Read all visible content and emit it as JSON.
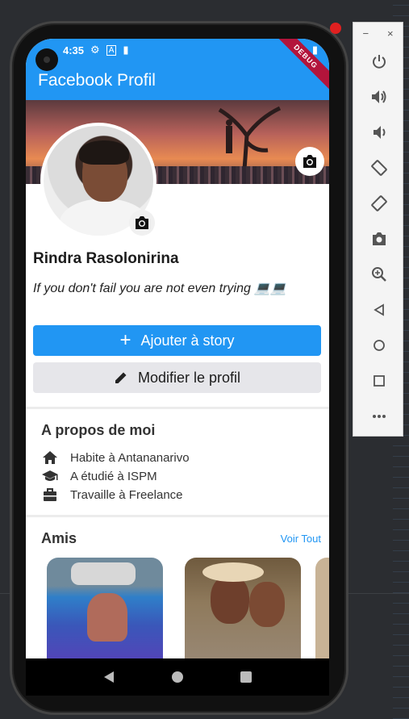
{
  "status_bar": {
    "time": "4:35"
  },
  "app_bar": {
    "title": "Facebook Profil",
    "debug_banner": "DEBUG"
  },
  "profile": {
    "name": "Rindra Rasolonirina",
    "bio": "If you don't fail you are not even trying 💻💻"
  },
  "buttons": {
    "add_story_label": "Ajouter à story",
    "edit_profile_label": "Modifier le profil"
  },
  "about": {
    "title": "A propos de moi",
    "items": [
      {
        "icon": "home-icon",
        "text": "Habite à Antananarivo"
      },
      {
        "icon": "school-icon",
        "text": "A étudié à ISPM"
      },
      {
        "icon": "briefcase-icon",
        "text": "Travaille à Freelance"
      }
    ]
  },
  "friends": {
    "title": "Amis",
    "see_all": "Voir Tout"
  },
  "colors": {
    "primary": "#2196f3",
    "secondary_button": "#e6e6ea",
    "debug_banner": "#b3143b"
  },
  "emulator_panel": {
    "window_controls": [
      "−",
      "×"
    ],
    "buttons": [
      "power-icon",
      "volume-up-icon",
      "volume-down-icon",
      "rotate-left-icon",
      "rotate-right-icon",
      "screenshot-icon",
      "zoom-icon",
      "back-icon",
      "home-icon",
      "overview-icon",
      "more-icon"
    ]
  }
}
